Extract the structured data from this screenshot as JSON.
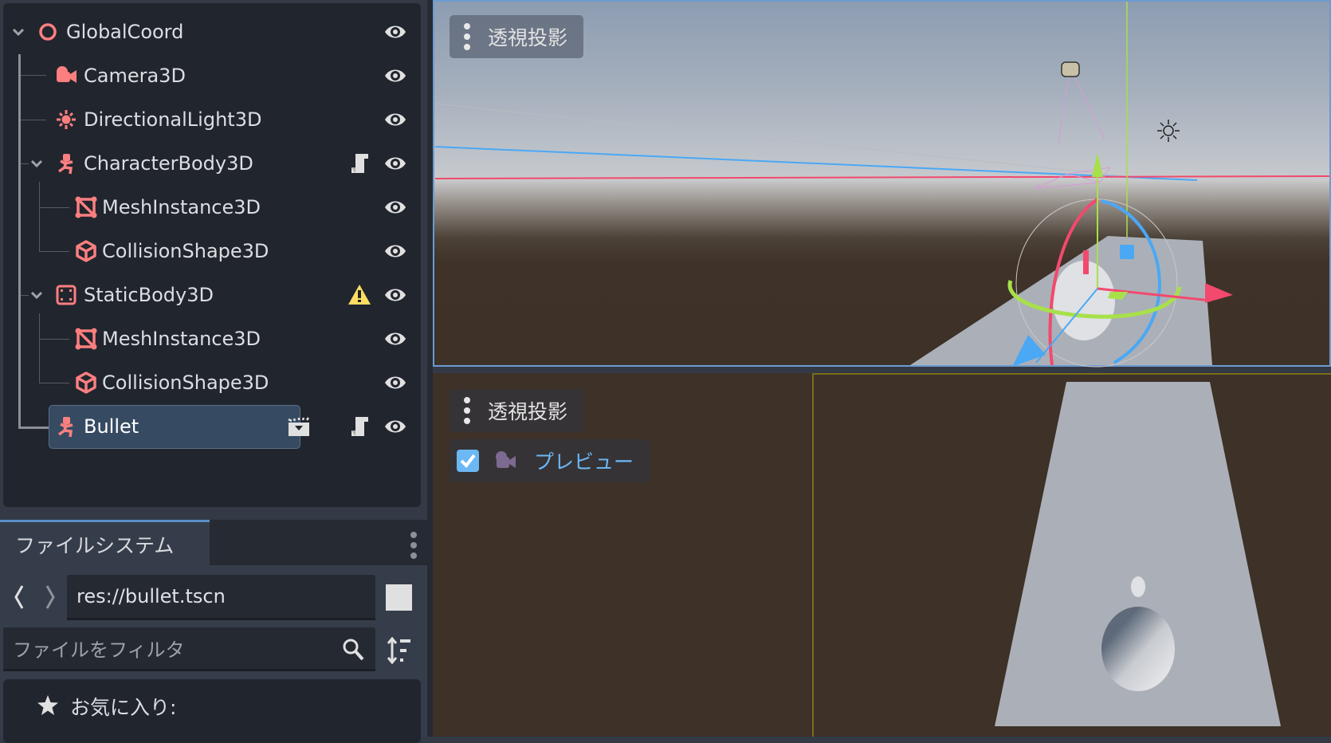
{
  "scene_tree": {
    "nodes": [
      {
        "name": "GlobalCoord",
        "icon": "node3d-circle-icon",
        "depth": 0,
        "expanded": true,
        "visible": true
      },
      {
        "name": "Camera3D",
        "icon": "camera-icon",
        "depth": 1,
        "visible": true
      },
      {
        "name": "DirectionalLight3D",
        "icon": "sun-light-icon",
        "depth": 1,
        "visible": true
      },
      {
        "name": "CharacterBody3D",
        "icon": "character-body-icon",
        "depth": 1,
        "expanded": true,
        "script": true,
        "visible": true
      },
      {
        "name": "MeshInstance3D",
        "icon": "mesh-instance-icon",
        "depth": 2,
        "visible": true
      },
      {
        "name": "CollisionShape3D",
        "icon": "collision-shape-icon",
        "depth": 2,
        "visible": true
      },
      {
        "name": "StaticBody3D",
        "icon": "static-body-icon",
        "depth": 1,
        "expanded": true,
        "warning": true,
        "visible": true
      },
      {
        "name": "MeshInstance3D",
        "icon": "mesh-instance-icon",
        "depth": 2,
        "visible": true
      },
      {
        "name": "CollisionShape3D",
        "icon": "collision-shape-icon",
        "depth": 2,
        "visible": true
      },
      {
        "name": "Bullet",
        "icon": "character-body-icon",
        "depth": 1,
        "selected": true,
        "instanced_scene": true,
        "script": true,
        "visible": true
      }
    ]
  },
  "filesystem": {
    "tab_label": "ファイルシステム",
    "path": "res://bullet.tscn",
    "filter_placeholder": "ファイルをフィルタ",
    "favorites_label": "お気に入り:"
  },
  "viewport_top": {
    "projection_label": "透視投影"
  },
  "viewport_bottom": {
    "projection_label": "透視投影",
    "preview_label": "プレビュー",
    "preview_checked": true
  },
  "colors": {
    "node_icon": "#fc7f7f",
    "accent": "#5a8fc6",
    "preview_text": "#6cb8f5",
    "warning": "#ffdd65"
  }
}
